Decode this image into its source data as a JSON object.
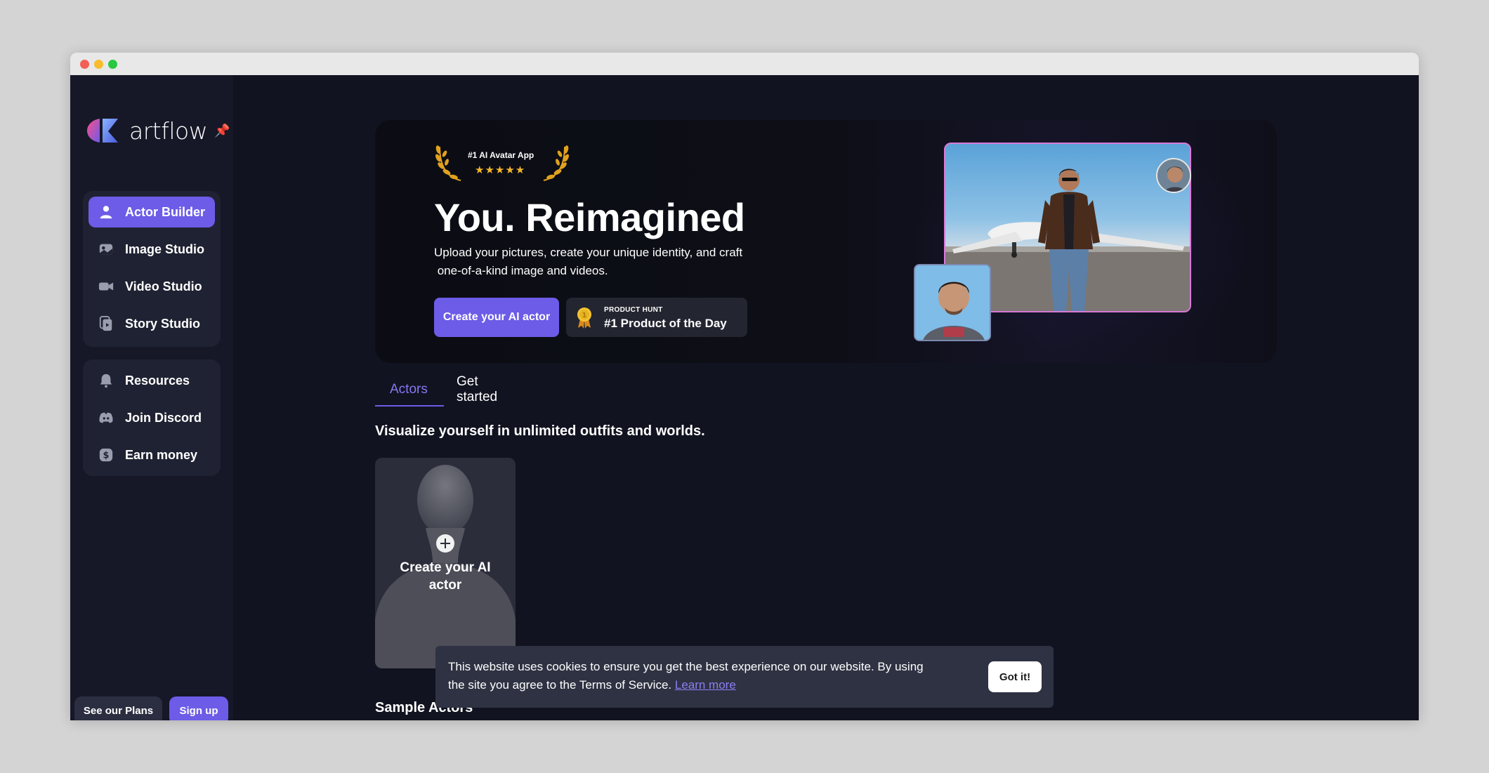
{
  "app": {
    "name": "artflow",
    "accent_color": "#6c5ce7"
  },
  "sidebar": {
    "main_items": [
      {
        "label": "Actor Builder",
        "icon": "user-icon",
        "active": true
      },
      {
        "label": "Image Studio",
        "icon": "image-icon",
        "active": false
      },
      {
        "label": "Video Studio",
        "icon": "video-camera-icon",
        "active": false
      },
      {
        "label": "Story Studio",
        "icon": "story-icon",
        "active": false
      }
    ],
    "secondary_items": [
      {
        "label": "Resources",
        "icon": "bell-icon"
      },
      {
        "label": "Join Discord",
        "icon": "discord-icon"
      },
      {
        "label": "Earn money",
        "icon": "dollar-icon"
      }
    ],
    "plans_label": "See our Plans",
    "signup_label": "Sign up"
  },
  "hero": {
    "award_label": "#1 AI Avatar App",
    "award_stars": "★★★★★",
    "title": "You. Reimagined",
    "subtitle_line1": "Upload your pictures, create your unique identity, and craft",
    "subtitle_line2": " one-of-a-kind image and videos.",
    "cta_label": "Create your AI actor",
    "product_hunt_small": "PRODUCT HUNT",
    "product_hunt_big": "#1 Product of the Day"
  },
  "tabs": [
    {
      "label": "Actors",
      "active": true
    },
    {
      "label": "Get started",
      "active": false
    }
  ],
  "main": {
    "section_title": "Visualize yourself in unlimited outfits and worlds.",
    "create_card_label_line1": "Create your AI",
    "create_card_label_line2": "actor",
    "sample_title": "Sample Actors"
  },
  "cookie": {
    "text_line1": "This website uses cookies to ensure you get the best experience on our website. By using",
    "text_line2": "the site you agree to the Terms of Service. ",
    "link_label": "Learn more",
    "button_label": "Got it!"
  }
}
